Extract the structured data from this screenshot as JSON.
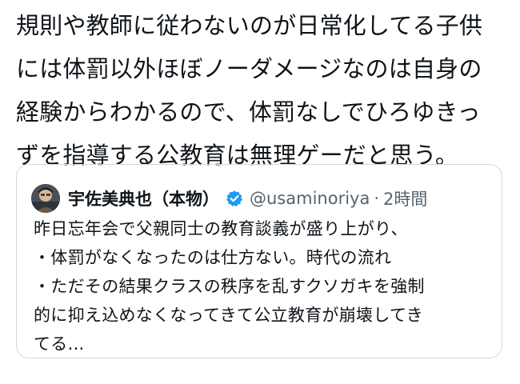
{
  "post": {
    "lines": [
      "規則や教師に従わないのが日常化してる子供",
      "には体罰以外ほぼノーダメージなのは自身の",
      "経験からわかるので、体罰なしでひろゆきっ",
      "ずを指導する公教育は無理ゲーだと思う。"
    ]
  },
  "quote": {
    "author_name": "宇佐美典也（本物）",
    "handle": "@usaminoriya",
    "separator": "·",
    "time": "2時間",
    "verified_icon": "verified-badge-icon",
    "verified_color": "#1d9bf0",
    "lines": [
      "昨日忘年会で父親同士の教育談義が盛り上がり、",
      "・体罰がなくなったのは仕方ない。時代の流れ",
      "・ただその結果クラスの秩序を乱すクソガキを強制",
      "的に抑え込めなくなってきて公立教育が崩壊してき",
      "てる..."
    ]
  }
}
